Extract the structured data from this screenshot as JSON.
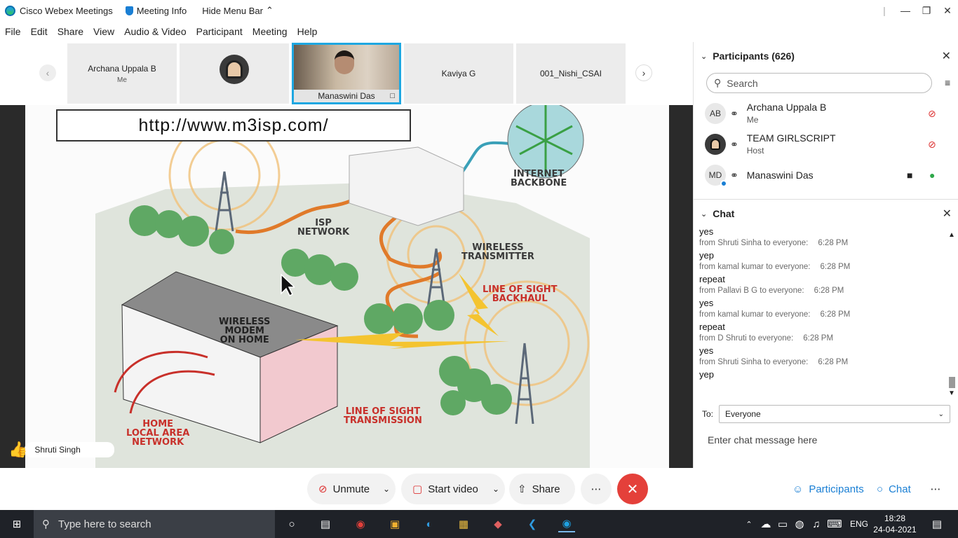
{
  "titlebar": {
    "app_title": "Cisco Webex Meetings",
    "meeting_info": "Meeting Info",
    "hide_menu": "Hide Menu Bar"
  },
  "menu": [
    "File",
    "Edit",
    "Share",
    "View",
    "Audio & Video",
    "Participant",
    "Meeting",
    "Help"
  ],
  "thumbnails": [
    {
      "name": "Archana Uppala B",
      "sub": "Me"
    },
    {
      "name": "",
      "sub": ""
    },
    {
      "name": "Manaswini Das",
      "sub": ""
    },
    {
      "name": "Kaviya G",
      "sub": ""
    },
    {
      "name": "001_Nishi_CSAI",
      "sub": ""
    }
  ],
  "slide": {
    "url": "http://www.m3isp.com/",
    "labels": {
      "internet_backbone": "INTERNET\nBACKBONE",
      "isp_network": "ISP\nNETWORK",
      "wireless_transmitter": "WIRELESS\nTRANSMITTER",
      "los_backhaul": "LINE OF SIGHT\nBACKHAUL",
      "wireless_modem": "WIRELESS\nMODEM\nON HOME",
      "home_lan": "HOME\nLOCAL AREA\nNETWORK",
      "los_transmission": "LINE OF SIGHT\nTRANSMISSION"
    }
  },
  "reaction": {
    "name": "Shruti Singh"
  },
  "participants": {
    "title": "Participants (626)",
    "search_placeholder": "Search",
    "list": [
      {
        "initials": "AB",
        "name": "Archana Uppala B",
        "role": "Me"
      },
      {
        "initials": "",
        "name": "TEAM GIRLSCRIPT",
        "role": "Host"
      },
      {
        "initials": "MD",
        "name": "Manaswini Das",
        "role": ""
      }
    ]
  },
  "chat": {
    "title": "Chat",
    "messages": [
      {
        "text": "yes",
        "from": "",
        "time": ""
      },
      {
        "text": "yep",
        "from": "from Shruti Sinha to everyone:",
        "time": "6:28 PM"
      },
      {
        "text": "repeat",
        "from": "from kamal kumar to everyone:",
        "time": "6:28 PM"
      },
      {
        "text": "yes",
        "from": "from Pallavi B G to everyone:",
        "time": "6:28 PM"
      },
      {
        "text": "repeat",
        "from": "from kamal kumar to everyone:",
        "time": "6:28 PM"
      },
      {
        "text": "yes",
        "from": "from D Shruti to everyone:",
        "time": "6:28 PM"
      },
      {
        "text": "yep",
        "from": "from Shruti Sinha to everyone:",
        "time": "6:28 PM"
      }
    ],
    "to_label": "To:",
    "to_value": "Everyone",
    "input_placeholder": "Enter chat message here"
  },
  "controls": {
    "unmute": "Unmute",
    "start_video": "Start video",
    "share": "Share",
    "participants": "Participants",
    "chat": "Chat"
  },
  "taskbar": {
    "search_placeholder": "Type here to search",
    "lang": "ENG",
    "time": "18:28",
    "date": "24-04-2021"
  },
  "colors": {
    "accent": "#1a7fd4",
    "end_call": "#e4403a",
    "active_border": "#1ea7e1"
  }
}
